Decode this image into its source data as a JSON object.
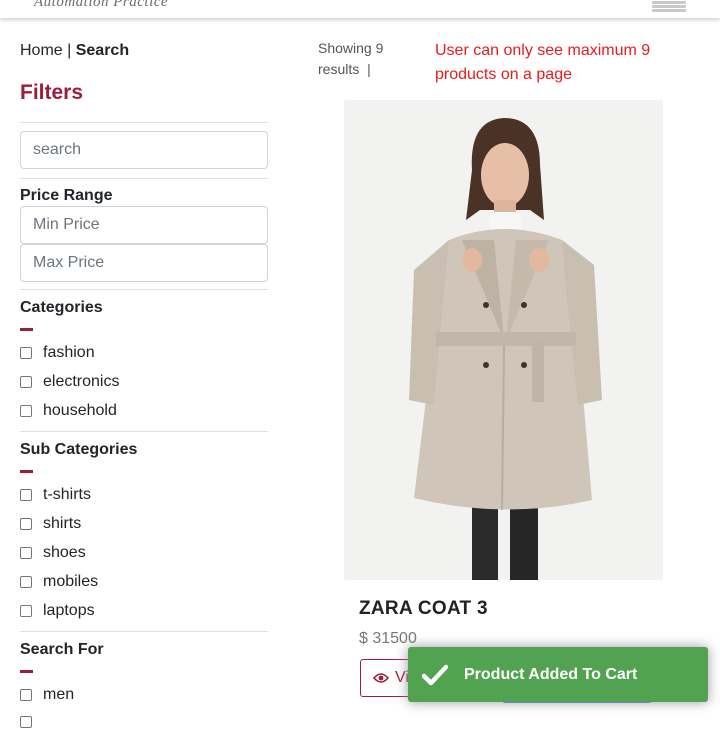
{
  "brand": {
    "name": "Automation Practice"
  },
  "breadcrumb": {
    "home": "Home",
    "separator": " | ",
    "current": "Search"
  },
  "filters": {
    "title": "Filters",
    "search_placeholder": "search",
    "price_range": {
      "label": "Price Range",
      "min_placeholder": "Min Price",
      "max_placeholder": "Max Price"
    },
    "categories": {
      "title": "Categories",
      "items": [
        "fashion",
        "electronics",
        "household"
      ]
    },
    "sub_categories": {
      "title": "Sub Categories",
      "items": [
        "t-shirts",
        "shirts",
        "shoes",
        "mobiles",
        "laptops"
      ]
    },
    "search_for": {
      "title": "Search For",
      "items": [
        "men"
      ]
    }
  },
  "results": {
    "showing": "Showing 9 results",
    "separator": "|",
    "limit_note": "User can only see maximum 9 products on a page"
  },
  "product": {
    "name": "ZARA COAT 3",
    "price": "$ 31500",
    "view_label": "View"
  },
  "toast": {
    "message": "Product Added To Cart"
  },
  "colors": {
    "accent": "#9c1f3a",
    "toast": "#51a351",
    "note": "#e81b1b",
    "primary_button": "#3f7de0"
  }
}
